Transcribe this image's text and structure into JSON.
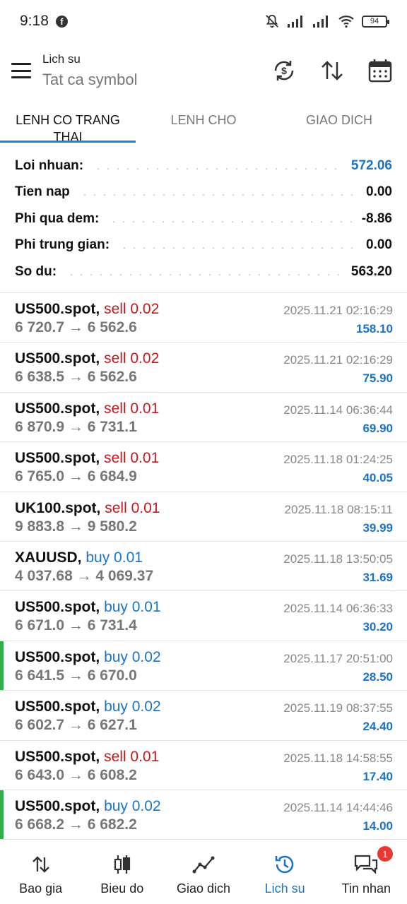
{
  "status_bar": {
    "time": "9:18",
    "battery": "94"
  },
  "header": {
    "title": "Lich su",
    "subtitle": "Tat ca symbol"
  },
  "tabs": [
    {
      "label": "LENH CO TRANG THAI",
      "active": true
    },
    {
      "label": "LENH CHO",
      "active": false
    },
    {
      "label": "GIAO DICH",
      "active": false
    }
  ],
  "summary": [
    {
      "label": "Loi nhuan:",
      "value": "572.06"
    },
    {
      "label": "Tien nap",
      "value": "0.00"
    },
    {
      "label": "Phi qua dem:",
      "value": "-8.86"
    },
    {
      "label": "Phi trung gian:",
      "value": "0.00"
    },
    {
      "label": "So du:",
      "value": "563.20"
    }
  ],
  "orders": [
    {
      "symbol": "US500.spot,",
      "side": "sell 0.02",
      "type": "sell",
      "prices": "6 720.7 → 6 562.6",
      "date": "2025.11.21 02:16:29",
      "profit": "158.10",
      "marked": false
    },
    {
      "symbol": "US500.spot,",
      "side": "sell 0.02",
      "type": "sell",
      "prices": "6 638.5 → 6 562.6",
      "date": "2025.11.21 02:16:29",
      "profit": "75.90",
      "marked": false
    },
    {
      "symbol": "US500.spot,",
      "side": "sell 0.01",
      "type": "sell",
      "prices": "6 870.9 → 6 731.1",
      "date": "2025.11.14 06:36:44",
      "profit": "69.90",
      "marked": false
    },
    {
      "symbol": "US500.spot,",
      "side": "sell 0.01",
      "type": "sell",
      "prices": "6 765.0 → 6 684.9",
      "date": "2025.11.18 01:24:25",
      "profit": "40.05",
      "marked": false
    },
    {
      "symbol": "UK100.spot,",
      "side": "sell 0.01",
      "type": "sell",
      "prices": "9 883.8 → 9 580.2",
      "date": "2025.11.18 08:15:11",
      "profit": "39.99",
      "marked": false
    },
    {
      "symbol": "XAUUSD,",
      "side": "buy 0.01",
      "type": "buy",
      "prices": "4 037.68 → 4 069.37",
      "date": "2025.11.18 13:50:05",
      "profit": "31.69",
      "marked": false
    },
    {
      "symbol": "US500.spot,",
      "side": "buy 0.01",
      "type": "buy",
      "prices": "6 671.0 → 6 731.4",
      "date": "2025.11.14 06:36:33",
      "profit": "30.20",
      "marked": false
    },
    {
      "symbol": "US500.spot,",
      "side": "buy 0.02",
      "type": "buy",
      "prices": "6 641.5 → 6 670.0",
      "date": "2025.11.17 20:51:00",
      "profit": "28.50",
      "marked": true
    },
    {
      "symbol": "US500.spot,",
      "side": "buy 0.02",
      "type": "buy",
      "prices": "6 602.7 → 6 627.1",
      "date": "2025.11.19 08:37:55",
      "profit": "24.40",
      "marked": false
    },
    {
      "symbol": "US500.spot,",
      "side": "sell 0.01",
      "type": "sell",
      "prices": "6 643.0 → 6 608.2",
      "date": "2025.11.18 14:58:55",
      "profit": "17.40",
      "marked": false
    },
    {
      "symbol": "US500.spot,",
      "side": "buy 0.02",
      "type": "buy",
      "prices": "6 668.2 → 6 682.2",
      "date": "2025.11.14 14:44:46",
      "profit": "14.00",
      "marked": true
    }
  ],
  "bottom_nav": [
    {
      "label": "Bao gia",
      "icon": "quotes-icon",
      "active": false
    },
    {
      "label": "Bieu do",
      "icon": "chart-icon",
      "active": false
    },
    {
      "label": "Giao dich",
      "icon": "trade-icon",
      "active": false
    },
    {
      "label": "Lich su",
      "icon": "history-icon",
      "active": true
    },
    {
      "label": "Tin nhan",
      "icon": "messages-icon",
      "active": false,
      "badge": "1"
    }
  ],
  "colors": {
    "accent": "#1a73c8",
    "sell": "#c8171c",
    "buy": "#1a73c8",
    "marker": "#2fae4a"
  }
}
